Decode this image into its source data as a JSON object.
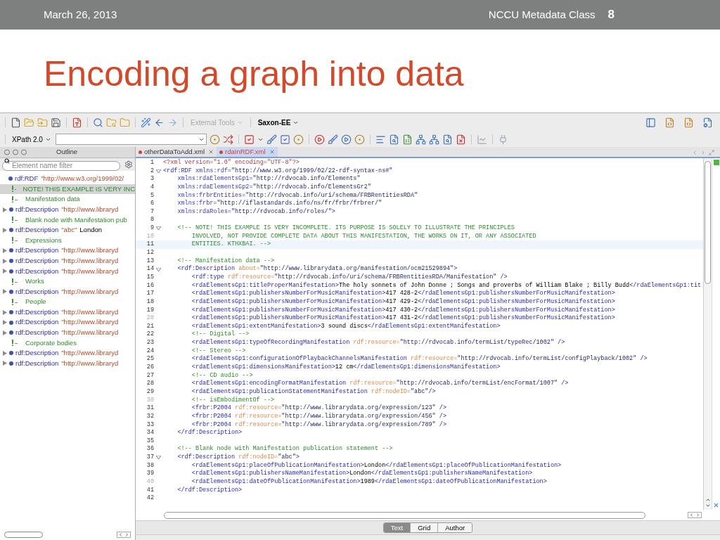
{
  "slide": {
    "date": "March 26, 2013",
    "course": "NCCU Metadata Class",
    "page_number": "8",
    "title": "Encoding a graph into data"
  },
  "toolbar": {
    "dropdowns": [
      {
        "label": "External Tools",
        "disabled": true
      },
      {
        "label": "Saxon-EE",
        "disabled": false
      }
    ],
    "xpath": {
      "label": "XPath 2.0"
    }
  },
  "outline": {
    "title": "Outline",
    "filter_placeholder": "Element name filter",
    "items": [
      {
        "kind": "element",
        "name": "rdf:RDF",
        "value": "\"http://www.w3.org/1999/02/",
        "collapsed": false,
        "selected": false,
        "children": [
          {
            "kind": "comment",
            "text": "NOTE! THIS EXAMPLE IS VERY INC",
            "selected": true
          },
          {
            "kind": "comment",
            "text": "Manifestation data",
            "selected": false
          },
          {
            "kind": "element",
            "name": "rdf:Description",
            "value": "\"http://www.libraryd",
            "collapsed": true,
            "selected": false
          },
          {
            "kind": "comment",
            "text": "Blank node with Manifestation pub",
            "selected": false
          },
          {
            "kind": "element",
            "name": "rdf:Description",
            "value": "\"abc\"",
            "extra": "London",
            "collapsed": true,
            "selected": false
          },
          {
            "kind": "comment",
            "text": "Expressions",
            "selected": false
          },
          {
            "kind": "element",
            "name": "rdf:Description",
            "value": "\"http://www.libraryd",
            "collapsed": true,
            "selected": false
          },
          {
            "kind": "element",
            "name": "rdf:Description",
            "value": "\"http://www.libraryd",
            "collapsed": true,
            "selected": false
          },
          {
            "kind": "element",
            "name": "rdf:Description",
            "value": "\"http://www.libraryd",
            "collapsed": true,
            "selected": false
          },
          {
            "kind": "comment",
            "text": "Works",
            "selected": false
          },
          {
            "kind": "element",
            "name": "rdf:Description",
            "value": "\"http://www.libraryd",
            "collapsed": true,
            "selected": false
          },
          {
            "kind": "comment",
            "text": "People",
            "selected": false
          },
          {
            "kind": "element",
            "name": "rdf:Description",
            "value": "\"http://www.libraryd",
            "collapsed": true,
            "selected": false
          },
          {
            "kind": "element",
            "name": "rdf:Description",
            "value": "\"http://www.libraryd",
            "collapsed": true,
            "selected": false
          },
          {
            "kind": "element",
            "name": "rdf:Description",
            "value": "\"http://www.libraryd",
            "collapsed": true,
            "selected": false
          },
          {
            "kind": "comment",
            "text": "Corporate bodies",
            "selected": false
          },
          {
            "kind": "element",
            "name": "rdf:Description",
            "value": "\"http://www.libraryd",
            "collapsed": true,
            "selected": false
          },
          {
            "kind": "element",
            "name": "rdf:Description",
            "value": "\"http://www.libraryd",
            "collapsed": true,
            "selected": false
          }
        ]
      }
    ]
  },
  "editor": {
    "tabs": [
      {
        "label": "otherDataToAdd.xml",
        "selected": false,
        "modified": true
      },
      {
        "label": "rdaInRDF.xml",
        "selected": true,
        "modified": true
      }
    ],
    "lines": [
      {
        "number": "1",
        "fold": false,
        "current": false,
        "tokens": [
          {
            "kind": "pi",
            "text": "<?xml version=\"1.0\" encoding=\"UTF-8\"?>"
          }
        ]
      },
      {
        "number": "2",
        "fold": true,
        "current": false,
        "tokens": [
          {
            "kind": "tag",
            "text": "<rdf:RDF "
          },
          {
            "kind": "attr",
            "text": "xmlns:rdf="
          },
          {
            "kind": "value",
            "text": "\"http://www.w3.org/1999/02/22-rdf-syntax-ns#\""
          }
        ]
      },
      {
        "number": "3",
        "fold": false,
        "current": false,
        "tokens": [
          {
            "kind": "attr",
            "text": "    xmlns:rdaElementsGp1="
          },
          {
            "kind": "value",
            "text": "\"http://rdvocab.info/Elements\""
          }
        ]
      },
      {
        "number": "4",
        "fold": false,
        "current": false,
        "tokens": [
          {
            "kind": "attr",
            "text": "    xmlns:rdaElementsGp2="
          },
          {
            "kind": "value",
            "text": "\"http://rdvocab.info/ElementsGr2\""
          }
        ]
      },
      {
        "number": "5",
        "fold": false,
        "current": false,
        "tokens": [
          {
            "kind": "attr",
            "text": "    xmlns:frbrEntities="
          },
          {
            "kind": "value",
            "text": "\"http://rdvocab.info/uri/schema/FRBRentitiesRDA\""
          }
        ]
      },
      {
        "number": "6",
        "fold": false,
        "current": false,
        "tokens": [
          {
            "kind": "attr",
            "text": "    xmlns:frbr="
          },
          {
            "kind": "value",
            "text": "\"http://iflastandards.info/ns/fr/frbr/frbrer/\""
          }
        ]
      },
      {
        "number": "7",
        "fold": false,
        "current": false,
        "tokens": [
          {
            "kind": "attr",
            "text": "    xmlns:rdaRoles="
          },
          {
            "kind": "value",
            "text": "\"http://rdvocab.info/roles/\""
          },
          {
            "kind": "tag",
            "text": ">"
          }
        ]
      },
      {
        "number": "8",
        "fold": false,
        "current": false
      },
      {
        "number": "9",
        "fold": true,
        "current": false,
        "tokens": [
          {
            "kind": "comment",
            "text": "    <!-- NOTE! THIS EXAMPLE IS VERY INCOMPLETE. ITS PURPOSE IS SOLELY TO ILLUSTRATE THE PRINCIPLES"
          }
        ]
      },
      {
        "number": "10",
        "fold": false,
        "current": false,
        "tokens": [
          {
            "kind": "comment",
            "text": "        INVOLVED, NOT PROVIDE COMPLETE DATA ABOUT THIS MANIFESTATION, THE WORKS ON IT, OR ANY ASSOCIATED"
          }
        ]
      },
      {
        "number": "11",
        "fold": false,
        "current": true,
        "tokens": [
          {
            "kind": "comment",
            "text": "        ENTITIES. KTHXBAI. -->"
          }
        ]
      },
      {
        "number": "12",
        "fold": false,
        "current": false
      },
      {
        "number": "13",
        "fold": false,
        "current": false,
        "tokens": [
          {
            "kind": "comment",
            "text": "    <!-- Manifestation data -->"
          }
        ]
      },
      {
        "number": "14",
        "fold": true,
        "current": false,
        "tokens": [
          {
            "kind": "tag",
            "text": "    <rdf:Description "
          },
          {
            "kind": "xattr",
            "text": "about="
          },
          {
            "kind": "value",
            "text": "\"http://www.librarydata.org/manifestation/ocm21529894\""
          },
          {
            "kind": "tag",
            "text": ">"
          }
        ]
      },
      {
        "number": "15",
        "fold": false,
        "current": false,
        "tokens": [
          {
            "kind": "tag",
            "text": "        <rdf:type "
          },
          {
            "kind": "xattr",
            "text": "rdf:resource="
          },
          {
            "kind": "value",
            "text": "\"http://rdvocab.info/uri/schema/FRBRentitiesRDA/Manifestation\""
          },
          {
            "kind": "tag",
            "text": " />"
          }
        ]
      },
      {
        "number": "16",
        "fold": false,
        "current": false,
        "tokens": [
          {
            "kind": "tag",
            "text": "        <rdaElementsGp1:titleProperManifestation>"
          },
          {
            "kind": "text",
            "text": "The holy sonnets of John Donne ; Songs and proverbs of William Blake ; Billy Budd"
          },
          {
            "kind": "tag",
            "text": "</rdaElementsGp1:tit"
          }
        ]
      },
      {
        "number": "17",
        "fold": false,
        "current": false,
        "tokens": [
          {
            "kind": "tag",
            "text": "        <rdaElementsGp1:publishersNumberForMusicManifestation>"
          },
          {
            "kind": "text",
            "text": "417 428-2"
          },
          {
            "kind": "tag",
            "text": "</rdaElementsGp1:publishersNumberForMusicManifestation>"
          }
        ]
      },
      {
        "number": "18",
        "fold": false,
        "current": false,
        "tokens": [
          {
            "kind": "tag",
            "text": "        <rdaElementsGp1:publishersNumberForMusicManifestation>"
          },
          {
            "kind": "text",
            "text": "417 429-2"
          },
          {
            "kind": "tag",
            "text": "</rdaElementsGp1:publishersNumberForMusicManifestation>"
          }
        ]
      },
      {
        "number": "19",
        "fold": false,
        "current": false,
        "tokens": [
          {
            "kind": "tag",
            "text": "        <rdaElementsGp1:publishersNumberForMusicManifestation>"
          },
          {
            "kind": "text",
            "text": "417 430-2"
          },
          {
            "kind": "tag",
            "text": "</rdaElementsGp1:publishersNumberForMusicManifestation>"
          }
        ]
      },
      {
        "number": "20",
        "fold": false,
        "current": false,
        "tokens": [
          {
            "kind": "tag",
            "text": "        <rdaElementsGp1:publishersNumberForMusicManifestation>"
          },
          {
            "kind": "text",
            "text": "417 431-2"
          },
          {
            "kind": "tag",
            "text": "</rdaElementsGp1:publishersNumberForMusicManifestation>"
          }
        ]
      },
      {
        "number": "21",
        "fold": false,
        "current": false,
        "tokens": [
          {
            "kind": "tag",
            "text": "        <rdaElementsGp1:extentManifestation>"
          },
          {
            "kind": "text",
            "text": "3 sound discs"
          },
          {
            "kind": "tag",
            "text": "</rdaElementsGp1:extentManifestation>"
          }
        ]
      },
      {
        "number": "22",
        "fold": false,
        "current": false,
        "tokens": [
          {
            "kind": "comment",
            "text": "        <!-- Digital -->"
          }
        ]
      },
      {
        "number": "23",
        "fold": false,
        "current": false,
        "tokens": [
          {
            "kind": "tag",
            "text": "        <rdaElementsGp1:typeOfRecordingManifestation "
          },
          {
            "kind": "xattr",
            "text": "rdf:resource="
          },
          {
            "kind": "value",
            "text": "\"http://rdvocab.info/termList/typeRec/1002\""
          },
          {
            "kind": "tag",
            "text": " />"
          }
        ]
      },
      {
        "number": "24",
        "fold": false,
        "current": false,
        "tokens": [
          {
            "kind": "comment",
            "text": "        <!-- Stereo -->"
          }
        ]
      },
      {
        "number": "25",
        "fold": false,
        "current": false,
        "tokens": [
          {
            "kind": "tag",
            "text": "        <rdaElementsGp1:configurationOfPlaybackChannelsManifestation "
          },
          {
            "kind": "xattr",
            "text": "rdf:resource="
          },
          {
            "kind": "value",
            "text": "\"http://rdvocab.info/termList/configPlayback/1002\""
          },
          {
            "kind": "tag",
            "text": " />"
          }
        ]
      },
      {
        "number": "26",
        "fold": false,
        "current": false,
        "tokens": [
          {
            "kind": "tag",
            "text": "        <rdaElementsGp1:dimensionsManifestation>"
          },
          {
            "kind": "text",
            "text": "12 cm"
          },
          {
            "kind": "tag",
            "text": "</rdaElementsGp1:dimensionsManifestation>"
          }
        ]
      },
      {
        "number": "27",
        "fold": false,
        "current": false,
        "tokens": [
          {
            "kind": "comment",
            "text": "        <!-- CD audio -->"
          }
        ]
      },
      {
        "number": "28",
        "fold": false,
        "current": false,
        "tokens": [
          {
            "kind": "tag",
            "text": "        <rdaElementsGp1:encodingFormatManifestation "
          },
          {
            "kind": "xattr",
            "text": "rdf:resource="
          },
          {
            "kind": "value",
            "text": "\"http://rdvocab.info/termList/encFormat/1007\""
          },
          {
            "kind": "tag",
            "text": " />"
          }
        ]
      },
      {
        "number": "29",
        "fold": false,
        "current": false,
        "tokens": [
          {
            "kind": "tag",
            "text": "        <rdaElementsGp1:publicationStatementManifestation "
          },
          {
            "kind": "xattr",
            "text": "rdf:nodeID="
          },
          {
            "kind": "value",
            "text": "\"abc\""
          },
          {
            "kind": "tag",
            "text": "/>"
          }
        ]
      },
      {
        "number": "30",
        "fold": false,
        "current": false,
        "tokens": [
          {
            "kind": "comment",
            "text": "        <!-- isEmbodimentOf -->"
          }
        ]
      },
      {
        "number": "31",
        "fold": false,
        "current": false,
        "tokens": [
          {
            "kind": "tag",
            "text": "        <frbr:P2004 "
          },
          {
            "kind": "xattr",
            "text": "rdf:resource="
          },
          {
            "kind": "value",
            "text": "\"http://www.librarydata.org/expression/123\""
          },
          {
            "kind": "tag",
            "text": " />"
          }
        ]
      },
      {
        "number": "32",
        "fold": false,
        "current": false,
        "tokens": [
          {
            "kind": "tag",
            "text": "        <frbr:P2004 "
          },
          {
            "kind": "xattr",
            "text": "rdf:resource="
          },
          {
            "kind": "value",
            "text": "\"http://www.librarydata.org/expression/456\""
          },
          {
            "kind": "tag",
            "text": " />"
          }
        ]
      },
      {
        "number": "33",
        "fold": false,
        "current": false,
        "tokens": [
          {
            "kind": "tag",
            "text": "        <frbr:P2004 "
          },
          {
            "kind": "xattr",
            "text": "rdf:resource="
          },
          {
            "kind": "value",
            "text": "\"http://www.librarydata.org/expression/789\""
          },
          {
            "kind": "tag",
            "text": " />"
          }
        ]
      },
      {
        "number": "34",
        "fold": false,
        "current": false,
        "tokens": [
          {
            "kind": "tag",
            "text": "    </rdf:Description>"
          }
        ]
      },
      {
        "number": "35",
        "fold": false,
        "current": false
      },
      {
        "number": "36",
        "fold": false,
        "current": false,
        "tokens": [
          {
            "kind": "comment",
            "text": "    <!-- Blank node with Manifestation publication statement -->"
          }
        ]
      },
      {
        "number": "37",
        "fold": true,
        "current": false,
        "tokens": [
          {
            "kind": "tag",
            "text": "    <rdf:Description "
          },
          {
            "kind": "xattr",
            "text": "rdf:nodeID="
          },
          {
            "kind": "value",
            "text": "\"abc\""
          },
          {
            "kind": "tag",
            "text": ">"
          }
        ]
      },
      {
        "number": "38",
        "fold": false,
        "current": false,
        "tokens": [
          {
            "kind": "tag",
            "text": "        <rdaElementsGp1:placeOfPublicationManifestation>"
          },
          {
            "kind": "text",
            "text": "London"
          },
          {
            "kind": "tag",
            "text": "</rdaElementsGp1:placeOfPublicationManifestation>"
          }
        ]
      },
      {
        "number": "39",
        "fold": false,
        "current": false,
        "tokens": [
          {
            "kind": "tag",
            "text": "        <rdaElementsGp1:publishersNameManifestation>"
          },
          {
            "kind": "text",
            "text": "London"
          },
          {
            "kind": "tag",
            "text": "</rdaElementsGp1:publishersNameManifestation>"
          }
        ]
      },
      {
        "number": "40",
        "fold": false,
        "current": false,
        "tokens": [
          {
            "kind": "tag",
            "text": "        <rdaElementsGp1:dateOfPublicationManifestation>"
          },
          {
            "kind": "text",
            "text": "1989"
          },
          {
            "kind": "tag",
            "text": "</rdaElementsGp1:dateOfPublicationManifestation>"
          }
        ]
      },
      {
        "number": "41",
        "fold": false,
        "current": false,
        "tokens": [
          {
            "kind": "tag",
            "text": "    </rdf:Description>"
          }
        ]
      },
      {
        "number": "42",
        "fold": false,
        "current": false
      }
    ],
    "modes": [
      {
        "label": "Text",
        "selected": true
      },
      {
        "label": "Grid",
        "selected": false
      },
      {
        "label": "Author",
        "selected": false
      }
    ]
  }
}
